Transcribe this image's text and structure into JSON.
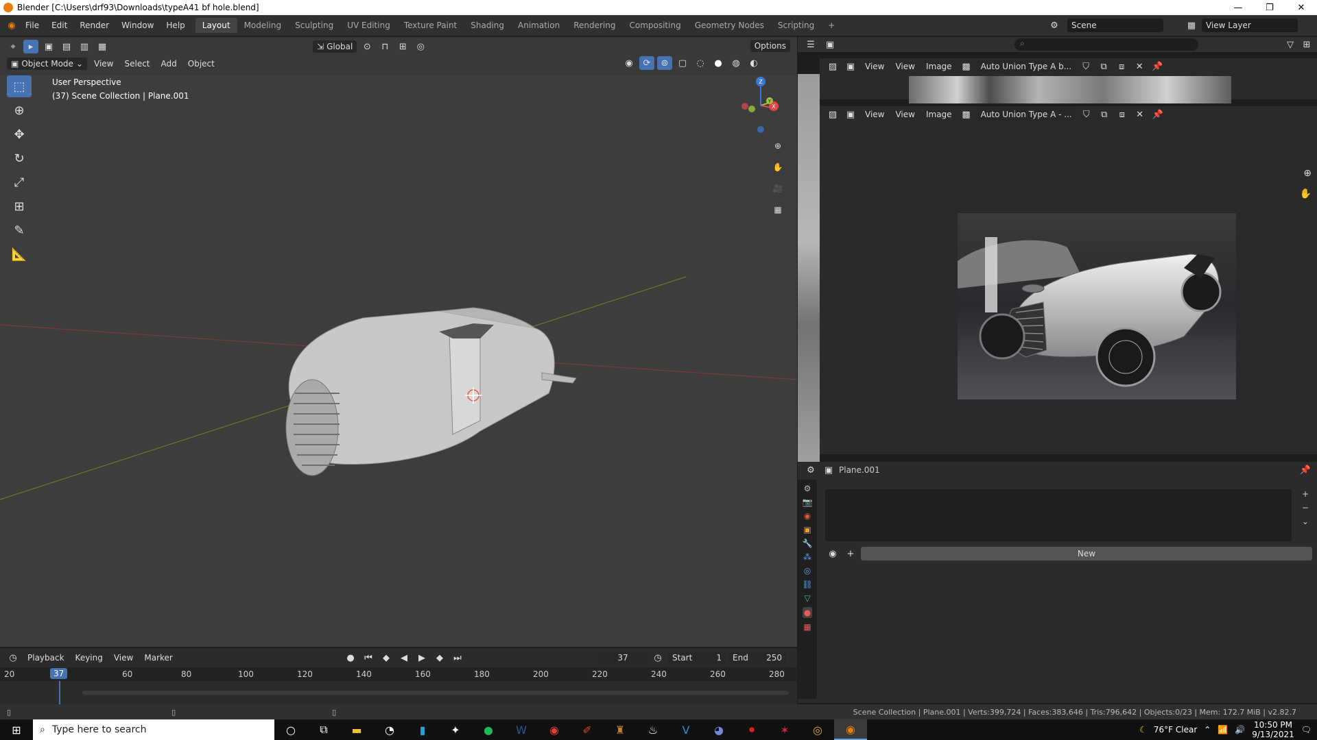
{
  "window": {
    "title": "Blender [C:\\Users\\drf93\\Downloads\\typeA41 bf hole.blend]",
    "controls": [
      "—",
      "❐",
      "✕"
    ]
  },
  "menubar": {
    "items": [
      "File",
      "Edit",
      "Render",
      "Window",
      "Help"
    ],
    "workspaces": [
      "Layout",
      "Modeling",
      "Sculpting",
      "UV Editing",
      "Texture Paint",
      "Shading",
      "Animation",
      "Rendering",
      "Compositing",
      "Geometry Nodes",
      "Scripting",
      "+"
    ],
    "active_workspace": "Layout",
    "scene": "Scene",
    "view_layer": "View Layer"
  },
  "viewport": {
    "mode": "Object Mode",
    "menus": [
      "View",
      "Select",
      "Add",
      "Object"
    ],
    "orientation": "Global",
    "options_label": "Options",
    "info_line1": "User Perspective",
    "info_line2": "(37) Scene Collection | Plane.001",
    "gizmo_labels": {
      "z": "Z",
      "y": "Y",
      "x": "X"
    }
  },
  "image_editors": [
    {
      "menus": [
        "View",
        "View",
        "Image"
      ],
      "image_name": "Auto Union Type A b..."
    },
    {
      "menus": [
        "View",
        "View",
        "Image"
      ],
      "image_name": "Auto Union Type A - ..."
    }
  ],
  "properties": {
    "object_name": "Plane.001",
    "new_button": "New"
  },
  "timeline": {
    "menus": [
      "Playback",
      "Keying",
      "View",
      "Marker"
    ],
    "current_frame": "37",
    "start_label": "Start",
    "start_value": "1",
    "end_label": "End",
    "end_value": "250",
    "ruler": [
      "20",
      "60",
      "80",
      "100",
      "120",
      "140",
      "160",
      "180",
      "200",
      "220",
      "240",
      "260",
      "280"
    ],
    "playhead": "37"
  },
  "statusbar": {
    "stats": "Scene Collection | Plane.001 | Verts:399,724 | Faces:383,646 | Tris:796,642 | Objects:0/23 | Mem: 172.7 MiB | v2.82.7"
  },
  "taskbar": {
    "search_placeholder": "Type here to search",
    "weather": "76°F Clear",
    "time": "10:50 PM",
    "date": "9/13/2021"
  },
  "colors": {
    "accent": "#4772b3",
    "header": "#303030",
    "viewport_bg": "#3d3d3d",
    "blender_orange": "#e87d0d"
  }
}
